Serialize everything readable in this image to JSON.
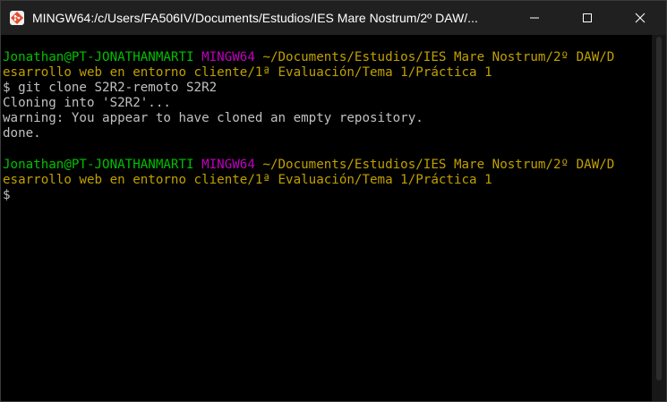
{
  "window": {
    "title": "MINGW64:/c/Users/FA506IV/Documents/Estudios/IES Mare Nostrum/2º DAW/...",
    "icon": "git-bash-icon",
    "controls": {
      "minimize": "minimize-icon",
      "maximize": "maximize-icon",
      "close": "close-icon"
    }
  },
  "colors": {
    "user_host": "#00c000",
    "shell": "#c000c0",
    "path": "#c0a000",
    "output": "#c0c0c0",
    "background": "#000000",
    "titlebar": "#202020"
  },
  "terminal": {
    "prompt1": {
      "user_host": "Jonathan@PT-JONATHANMARTI",
      "shell": "MINGW64",
      "path_line1": "~/Documents/Estudios/IES Mare Nostrum/2º DAW/D",
      "path_line2": "esarrollo web en entorno cliente/1ª Evaluación/Tema 1/Práctica 1",
      "command": "$ git clone S2R2-remoto S2R2"
    },
    "output": [
      "Cloning into 'S2R2'...",
      "warning: You appear to have cloned an empty repository.",
      "done."
    ],
    "prompt2": {
      "user_host": "Jonathan@PT-JONATHANMARTI",
      "shell": "MINGW64",
      "path_line1": "~/Documents/Estudios/IES Mare Nostrum/2º DAW/D",
      "path_line2": "esarrollo web en entorno cliente/1ª Evaluación/Tema 1/Práctica 1",
      "command": "$"
    }
  }
}
